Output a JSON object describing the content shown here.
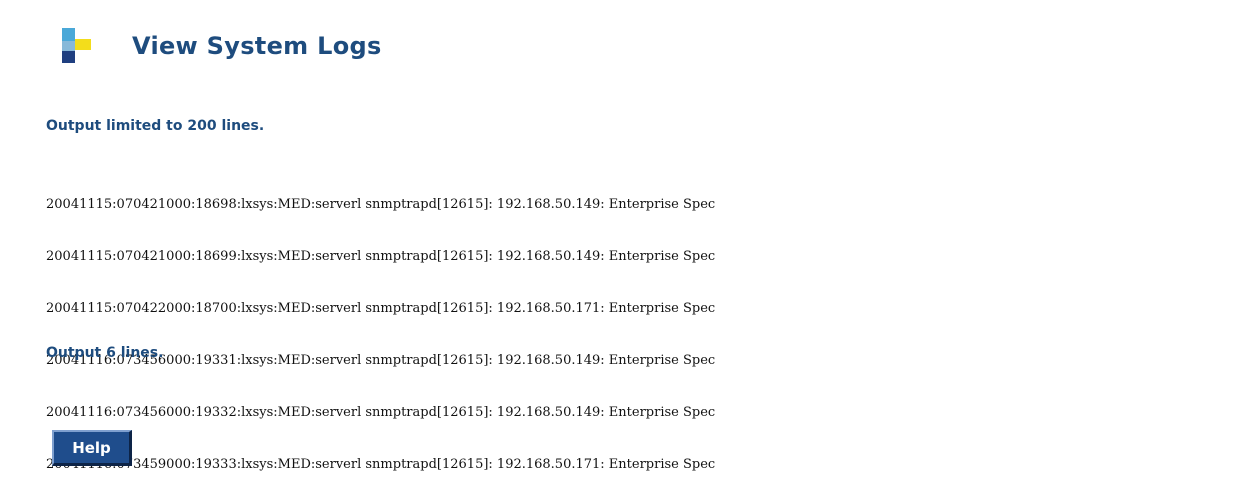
{
  "header": {
    "title": "View System Logs"
  },
  "notes": {
    "limit": "Output limited to 200 lines.",
    "count": "Output 6 lines."
  },
  "log_lines": [
    "20041115:070421000:18698:lxsys:MED:serverl snmptrapd[12615]: 192.168.50.149: Enterprise Spec",
    "20041115:070421000:18699:lxsys:MED:serverl snmptrapd[12615]: 192.168.50.149: Enterprise Spec",
    "20041115:070422000:18700:lxsys:MED:serverl snmptrapd[12615]: 192.168.50.171: Enterprise Spec",
    "20041116:073456000:19331:lxsys:MED:serverl snmptrapd[12615]: 192.168.50.149: Enterprise Spec",
    "20041116:073456000:19332:lxsys:MED:serverl snmptrapd[12615]: 192.168.50.149: Enterprise Spec",
    "20041116:073459000:19333:lxsys:MED:serverl snmptrapd[12615]: 192.168.50.171: Enterprise Spec"
  ],
  "buttons": {
    "help": "Help"
  },
  "icons": {
    "logo": "logo-icon"
  },
  "colors": {
    "heading": "#1e4c7e",
    "button_bg": "#1f4d8c",
    "logo_blue": "#4aa8d8",
    "logo_yellow": "#f3dd1b",
    "logo_dark": "#1f3f80"
  }
}
